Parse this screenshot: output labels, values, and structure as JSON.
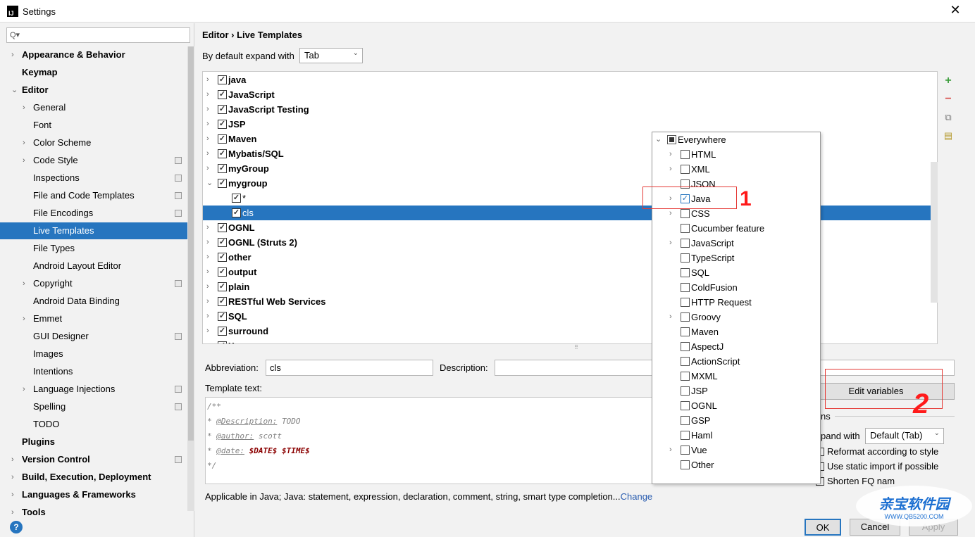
{
  "window": {
    "title": "Settings",
    "close": "✕",
    "app_icon": "IJ"
  },
  "sidebar": {
    "search_placeholder": "Q▾",
    "items": [
      {
        "label": "Appearance & Behavior",
        "level": 0,
        "bold": true,
        "chevron": "›"
      },
      {
        "label": "Keymap",
        "level": 0,
        "bold": true
      },
      {
        "label": "Editor",
        "level": 0,
        "bold": true,
        "chevron": "⌄"
      },
      {
        "label": "General",
        "level": 1,
        "chevron": "›"
      },
      {
        "label": "Font",
        "level": 1
      },
      {
        "label": "Color Scheme",
        "level": 1,
        "chevron": "›"
      },
      {
        "label": "Code Style",
        "level": 1,
        "chevron": "›",
        "project": true
      },
      {
        "label": "Inspections",
        "level": 1,
        "project": true
      },
      {
        "label": "File and Code Templates",
        "level": 1,
        "project": true
      },
      {
        "label": "File Encodings",
        "level": 1,
        "project": true
      },
      {
        "label": "Live Templates",
        "level": 1,
        "selected": true
      },
      {
        "label": "File Types",
        "level": 1
      },
      {
        "label": "Android Layout Editor",
        "level": 1
      },
      {
        "label": "Copyright",
        "level": 1,
        "chevron": "›",
        "project": true
      },
      {
        "label": "Android Data Binding",
        "level": 1
      },
      {
        "label": "Emmet",
        "level": 1,
        "chevron": "›"
      },
      {
        "label": "GUI Designer",
        "level": 1,
        "project": true
      },
      {
        "label": "Images",
        "level": 1
      },
      {
        "label": "Intentions",
        "level": 1
      },
      {
        "label": "Language Injections",
        "level": 1,
        "chevron": "›",
        "project": true
      },
      {
        "label": "Spelling",
        "level": 1,
        "project": true
      },
      {
        "label": "TODO",
        "level": 1
      },
      {
        "label": "Plugins",
        "level": 0,
        "bold": true
      },
      {
        "label": "Version Control",
        "level": 0,
        "bold": true,
        "chevron": "›",
        "project": true
      },
      {
        "label": "Build, Execution, Deployment",
        "level": 0,
        "bold": true,
        "chevron": "›"
      },
      {
        "label": "Languages & Frameworks",
        "level": 0,
        "bold": true,
        "chevron": "›"
      },
      {
        "label": "Tools",
        "level": 0,
        "bold": true,
        "chevron": "›"
      }
    ],
    "help": "?"
  },
  "main": {
    "breadcrumb": "Editor  ›  Live Templates",
    "expand_label": "By default expand with",
    "expand_value": "Tab",
    "groups": [
      {
        "label": "java",
        "checked": true,
        "chevron": "›"
      },
      {
        "label": "JavaScript",
        "checked": true,
        "chevron": "›"
      },
      {
        "label": "JavaScript Testing",
        "checked": true,
        "chevron": "›"
      },
      {
        "label": "JSP",
        "checked": true,
        "chevron": "›"
      },
      {
        "label": "Maven",
        "checked": true,
        "chevron": "›"
      },
      {
        "label": "Mybatis/SQL",
        "checked": true,
        "chevron": "›"
      },
      {
        "label": "myGroup",
        "checked": true,
        "chevron": "›"
      },
      {
        "label": "mygroup",
        "checked": true,
        "chevron": "⌄"
      },
      {
        "label": "*",
        "checked": true,
        "child": true
      },
      {
        "label": "cls",
        "checked": true,
        "child": true,
        "selected": true
      },
      {
        "label": "OGNL",
        "checked": true,
        "chevron": "›"
      },
      {
        "label": "OGNL (Struts 2)",
        "checked": true,
        "chevron": "›"
      },
      {
        "label": "other",
        "checked": true,
        "chevron": "›"
      },
      {
        "label": "output",
        "checked": true,
        "chevron": "›"
      },
      {
        "label": "plain",
        "checked": true,
        "chevron": "›"
      },
      {
        "label": "RESTful Web Services",
        "checked": true,
        "chevron": "›"
      },
      {
        "label": "SQL",
        "checked": true,
        "chevron": "›"
      },
      {
        "label": "surround",
        "checked": true,
        "chevron": "›"
      },
      {
        "label": "X...",
        "checked": true,
        "chevron": "›"
      }
    ],
    "toolbar": {
      "add": "+",
      "remove": "−",
      "copy": "⧉",
      "notes": "▤"
    },
    "abbreviation_label": "Abbreviation:",
    "abbreviation_value": "cls",
    "description_label": "Description:",
    "description_value": "",
    "template_label": "Template text:",
    "template_lines": {
      "l1": "/**",
      "l2_star": "* ",
      "l2_tag": "@Description:",
      "l2_rest": " TODO",
      "l3_star": "* ",
      "l3_tag": "@author:",
      "l3_rest": " scott",
      "l4_star": "* ",
      "l4_tag": "@date:",
      "l4_var": " $DATE$ $TIME$",
      "l5": "*/"
    },
    "applicable_text": "Applicable in Java; Java: statement, expression, declaration, comment, string, smart type completion...",
    "change_link": "Change",
    "edit_variables": "Edit variables",
    "options_label": "ns",
    "options_expand_label": "pand with",
    "options_expand_value": "Default (Tab)",
    "reformat": "Reformat according to style",
    "static_import": "Use static import if possible",
    "shorten_fq": "Shorten FQ nam",
    "ok": "OK",
    "cancel": "Cancel",
    "apply": "Apply"
  },
  "context_popup": {
    "root": "Everywhere",
    "items": [
      {
        "label": "HTML",
        "chevron": true
      },
      {
        "label": "XML",
        "chevron": true
      },
      {
        "label": "JSON"
      },
      {
        "label": "Java",
        "chevron": true,
        "checked": true
      },
      {
        "label": "CSS",
        "chevron": true
      },
      {
        "label": "Cucumber feature"
      },
      {
        "label": "JavaScript",
        "chevron": true
      },
      {
        "label": "TypeScript"
      },
      {
        "label": "SQL"
      },
      {
        "label": "ColdFusion"
      },
      {
        "label": "HTTP Request"
      },
      {
        "label": "Groovy",
        "chevron": true
      },
      {
        "label": "Maven"
      },
      {
        "label": "AspectJ"
      },
      {
        "label": "ActionScript"
      },
      {
        "label": "MXML"
      },
      {
        "label": "JSP"
      },
      {
        "label": "OGNL"
      },
      {
        "label": "GSP"
      },
      {
        "label": "Haml"
      },
      {
        "label": "Vue",
        "chevron": true
      },
      {
        "label": "Other"
      }
    ]
  },
  "annotations": {
    "mark1": "1",
    "mark2": "2",
    "color": "#e53935"
  },
  "watermark": {
    "text": "亲宝软件园",
    "url": "WWW.QB5200.COM"
  },
  "colors": {
    "accent": "#2675bf",
    "link": "#2a5db0",
    "variable": "#8b0000"
  }
}
